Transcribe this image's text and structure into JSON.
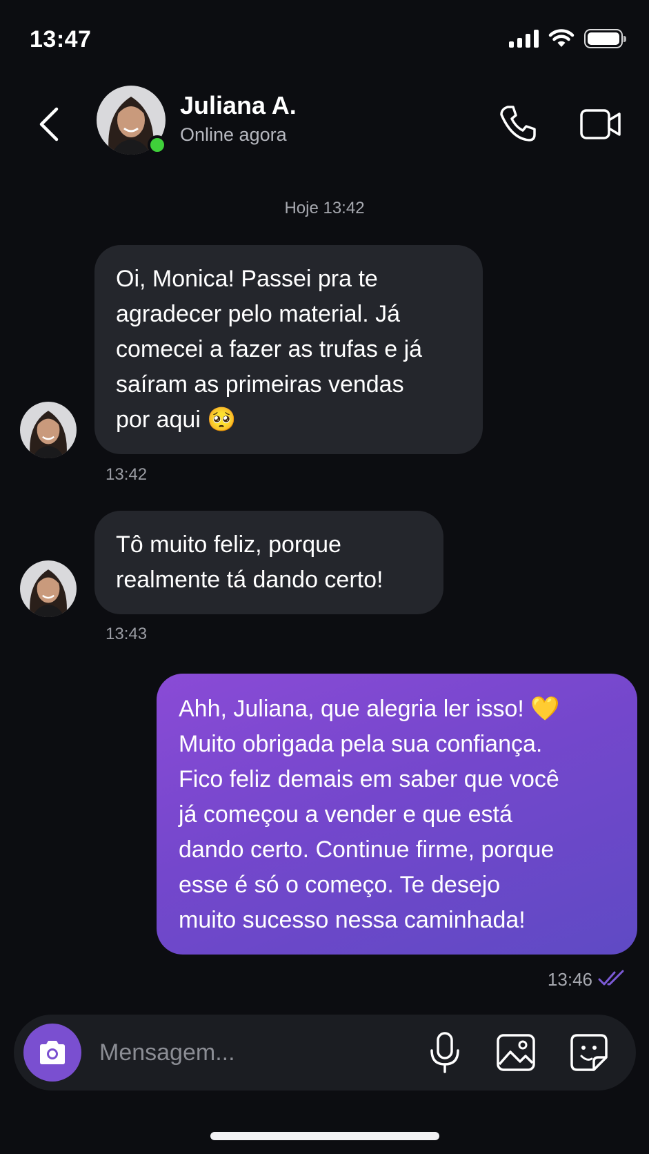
{
  "status_bar": {
    "time": "13:47"
  },
  "header": {
    "contact_name": "Juliana A.",
    "contact_status": "Online agora"
  },
  "conversation": {
    "day_stamp": "Hoje 13:42",
    "messages": [
      {
        "direction": "incoming",
        "text": "Oi, Monica! Passei pra te\nagradecer pelo material. Já\ncomecei a fazer as trufas e já\nsaíram as primeiras vendas\npor aqui 🥺",
        "time": "13:42"
      },
      {
        "direction": "incoming",
        "text": "Tô muito feliz, porque\nrealmente tá dando certo!",
        "time": "13:43"
      },
      {
        "direction": "outgoing",
        "text": "Ahh, Juliana, que alegria ler isso! 💛\nMuito obrigada pela sua confiança.\nFico feliz demais em saber que você\njá começou a vender e que está\ndando certo. Continue firme, porque\nesse é só o começo. Te desejo\nmuito sucesso nessa caminhada!",
        "time": "13:46",
        "status": "read"
      }
    ]
  },
  "composer": {
    "placeholder": "Mensagem..."
  },
  "colors": {
    "background": "#0c0d11",
    "incoming_bubble": "#24262c",
    "outgoing_bubble_start": "#8a4bd6",
    "outgoing_bubble_end": "#5f4ac4",
    "online_dot": "#3fd03a",
    "accent": "#7a4fd0"
  }
}
